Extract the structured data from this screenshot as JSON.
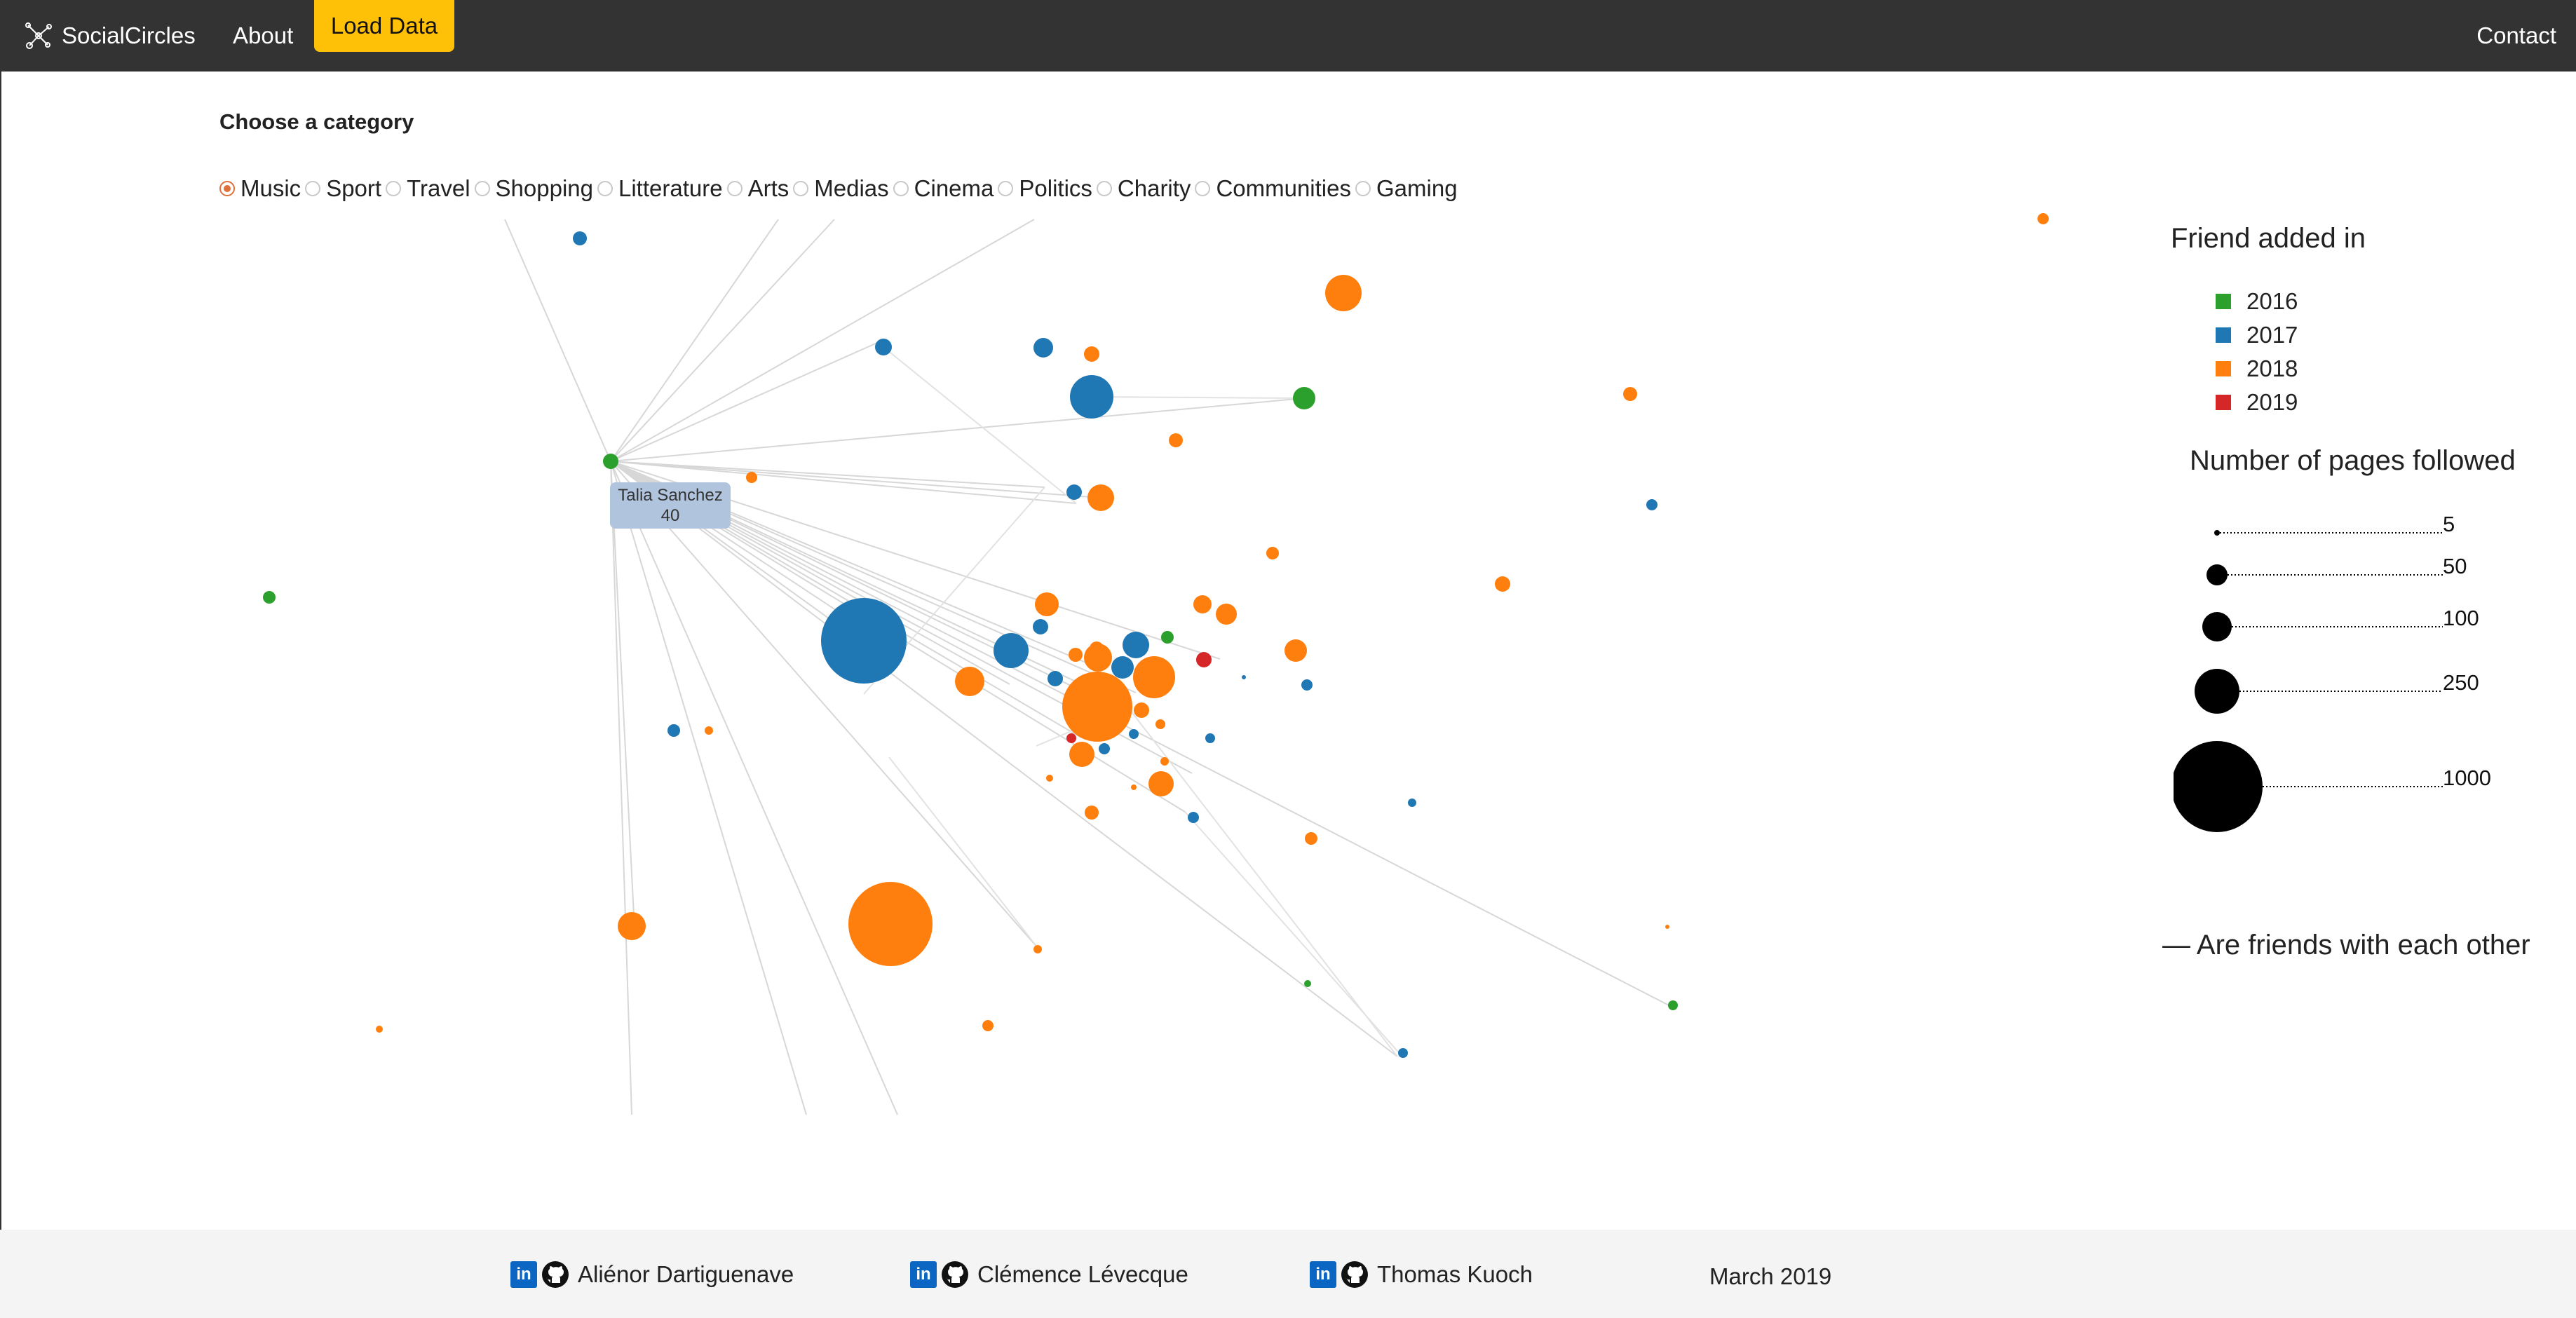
{
  "navbar": {
    "brand": "SocialCircles",
    "about": "About",
    "load": "Load Data",
    "contact": "Contact"
  },
  "chooser": {
    "title": "Choose a category",
    "selected": "Music",
    "options": [
      "Music",
      "Sport",
      "Travel",
      "Shopping",
      "Litterature",
      "Arts",
      "Medias",
      "Cinema",
      "Politics",
      "Charity",
      "Communities",
      "Gaming"
    ]
  },
  "graph": {
    "tooltip_name": "Talia Sanchez",
    "tooltip_value": "40"
  },
  "legend": {
    "title": "Friend added in",
    "years": [
      {
        "label": "2016",
        "color": "#2ca02c"
      },
      {
        "label": "2017",
        "color": "#1f77b4"
      },
      {
        "label": "2018",
        "color": "#ff7f0e"
      },
      {
        "label": "2019",
        "color": "#d62728"
      }
    ],
    "size_title": "Number of pages followed",
    "sizes": [
      "5",
      "50",
      "100",
      "250",
      "1000"
    ],
    "friends_note": "— Are friends with each other"
  },
  "footer": {
    "authors": [
      "Aliénor Dartiguenave",
      "Clémence Lévecque",
      "Thomas Kuoch"
    ],
    "date": "March 2019"
  }
}
